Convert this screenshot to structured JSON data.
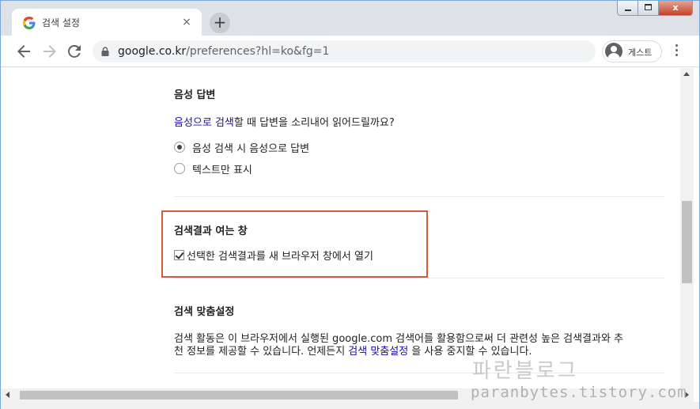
{
  "browser": {
    "tab": {
      "title": "검색 설정",
      "close": "×"
    },
    "new_tab": "+",
    "window_controls": {
      "close": "x"
    },
    "address": {
      "host": "google.co.kr",
      "path": "/preferences?hl=ko&fg=1"
    },
    "profile": {
      "label": "게스트"
    },
    "colors": {
      "frame": "#dee1e6",
      "omnibox": "#f1f3f4",
      "link": "#1a0dab"
    }
  },
  "page": {
    "voice_answers": {
      "title": "음성 답변",
      "description_link": "음성으로 검색",
      "description_rest": "할 때 답변을 소리내어 읽어드릴까요?",
      "options": [
        {
          "label": "음성 검색 시 음성으로 답변",
          "selected": true
        },
        {
          "label": "텍스트만 표시",
          "selected": false
        }
      ]
    },
    "results_window": {
      "title": "검색결과 여는 창",
      "checkbox_label": "선택한 검색결과를 새 브라우저 창에서 열기",
      "checked": true,
      "highlight_color": "#cf5a3c"
    },
    "personalization": {
      "title": "검색 맞춤설정",
      "line1": "검색 활동은 이 브라우저에서 실행된 google.com 검색어를 활용함으로써 더 관련성 높은 검색결과와 추",
      "line2_prefix": "천 정보를 제공할 수 있습니다. 언제든지 ",
      "line2_link": "검색 맞춤설정",
      "line2_suffix": " 을 사용 중지할 수 있습니다."
    }
  },
  "watermark": {
    "korean": "파란블로그",
    "url": "paranbytes.tistory.com"
  }
}
